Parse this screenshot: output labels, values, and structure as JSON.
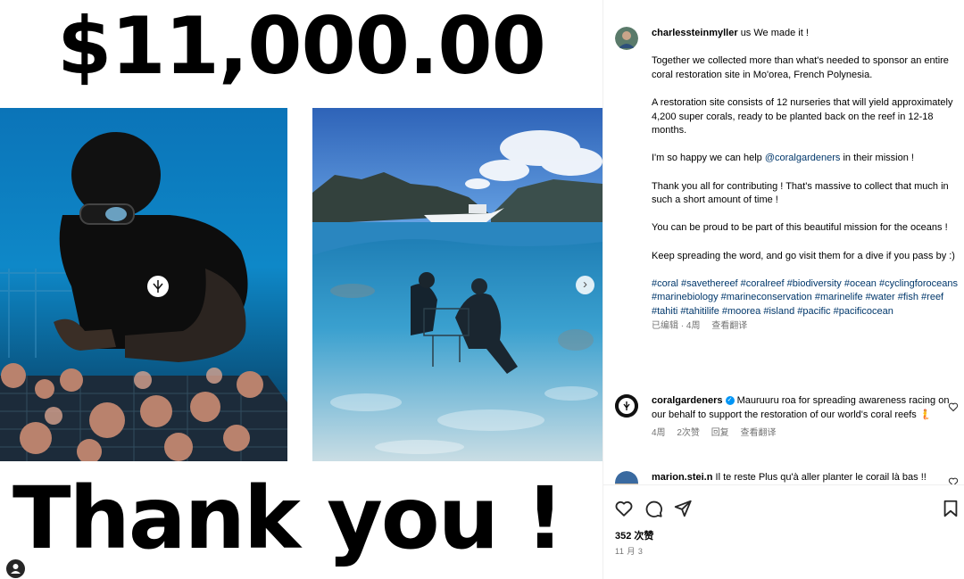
{
  "post_image": {
    "amount": "$11,000.00",
    "thank_you": "Thank you !"
  },
  "caption": {
    "username": "charlessteinmyller",
    "paragraphs": [
      "us We made it !",
      "Together we collected more than what's needed to sponsor an entire coral restoration site in Mo'orea, French Polynesia.",
      "A restoration site consists of 12 nurseries that will yield approximately 4,200 super corals, ready to be planted back on the reef in 12-18 months.",
      "I'm so happy we can help",
      "Thank you all for contributing ! That's massive to collect that much in such a short amount of time !",
      "You can be proud to be part of this beautiful mission for the oceans !",
      "Keep spreading the word, and go visit them for a dive if you pass by :)"
    ],
    "mention": "@coralgardeners",
    "mention_suffix": " in their mission !",
    "hashtags": "#coral #savethereef #coralreef #biodiversity #ocean #cyclingforoceans #marinebiology #marineconservation #marinelife #water #fish #reef #tahiti #tahitilife #moorea #island #pacific #pacificocean",
    "edited": "已编辑",
    "time": "· 4周",
    "translate": "查看翻译"
  },
  "comments": [
    {
      "username": "coralgardeners",
      "verified": true,
      "text": "Mauruuru roa for spreading awareness racing on our behalf to support the restoration of our world's coral reefs 🧜",
      "time": "4周",
      "likes": "2次赞",
      "reply": "回复",
      "translate": "查看翻译"
    },
    {
      "username": "marion.stei.n",
      "text": "Il te reste Plus qu'à aller planter le corail là bas !!"
    }
  ],
  "actions": {
    "likes": "352 次赞",
    "date": "11 月 3"
  },
  "colors": {
    "link": "#00376b",
    "meta": "#737373",
    "verified": "#0095f6"
  }
}
